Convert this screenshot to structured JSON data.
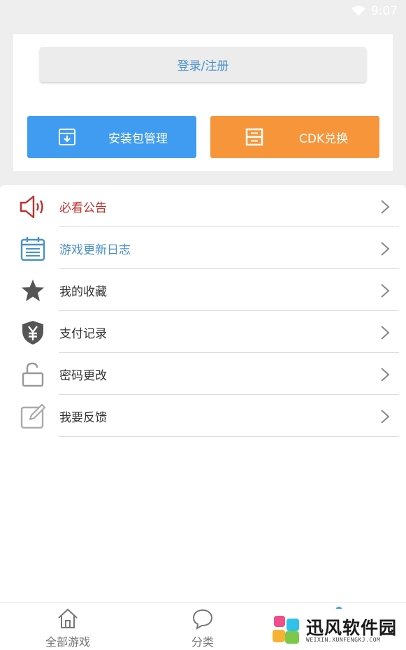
{
  "status_bar": {
    "time": "9:07",
    "wifi_icon": "wifi-icon"
  },
  "account": {
    "login_label": "登录/注册"
  },
  "actions": {
    "package_manager": {
      "label": "安装包管理",
      "icon": "download-box-icon",
      "color": "#3f9cf0"
    },
    "cdk_redeem": {
      "label": "CDK兑换",
      "icon": "card-icon",
      "color": "#f7953a"
    }
  },
  "menu": {
    "items": [
      {
        "label": "必看公告",
        "icon": "speaker-icon",
        "color": "#c0302b"
      },
      {
        "label": "游戏更新日志",
        "icon": "calendar-icon",
        "color": "#4a90c8"
      },
      {
        "label": "我的收藏",
        "icon": "star-icon",
        "color": "#333333"
      },
      {
        "label": "支付记录",
        "icon": "yuan-shield-icon",
        "color": "#333333"
      },
      {
        "label": "密码更改",
        "icon": "unlock-icon",
        "color": "#333333"
      },
      {
        "label": "我要反馈",
        "icon": "edit-icon",
        "color": "#333333"
      }
    ]
  },
  "tabs": [
    {
      "label": "全部游戏",
      "icon": "home-icon"
    },
    {
      "label": "分类",
      "icon": "chat-bubble-icon"
    }
  ],
  "watermark": {
    "title": "迅风软件园",
    "subtitle": "WEIXIN.XUNFENGKJ.COM"
  }
}
